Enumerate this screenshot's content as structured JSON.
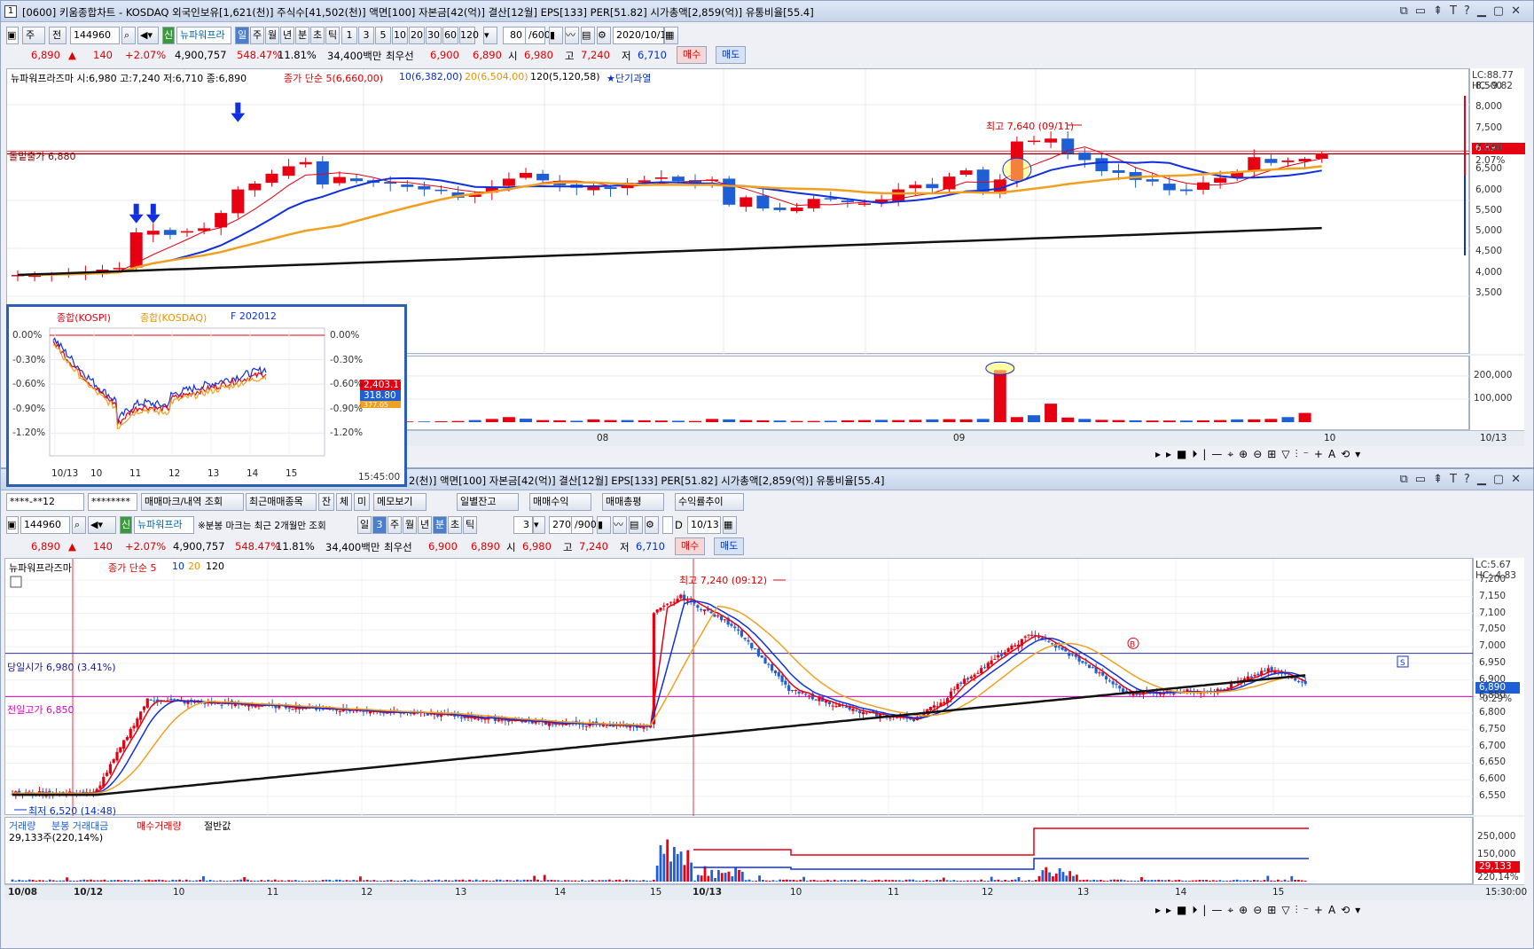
{
  "top": {
    "title": "[0600] 키움종합차트 - KOSDAQ 외국인보유[1,621(천)] 주식수[41,502(천)] 액면[100] 자본금[42(억)] 결산[12월] EPS[133] PER[51.82] 시가총액[2,859(억)] 유통비율[55.4]",
    "window_num": "1",
    "toolbar": {
      "type1": "주",
      "type2": "전",
      "code": "144960",
      "name": "뉴파워프라",
      "periods": [
        "일",
        "주",
        "월",
        "년",
        "분",
        "초",
        "틱"
      ],
      "mins": [
        "1",
        "3",
        "5",
        "10",
        "20",
        "30",
        "60",
        "120"
      ],
      "count": "80",
      "count_total": "/600",
      "date": "2020/10/13"
    },
    "quote": {
      "price": "6,890",
      "change": "140",
      "change_pct": "+2.07%",
      "volume": "4,900,757",
      "vol_ratio": "548.47%",
      "turnover": "11.81%",
      "amount": "34,400백만",
      "best_label": "최우선",
      "ask": "6,900",
      "bid": "6,890",
      "open_label": "시",
      "open": "6,980",
      "high_label": "고",
      "high": "7,240",
      "low_label": "저",
      "low": "6,710",
      "buy": "매수",
      "sell": "매도"
    },
    "legend": {
      "name": "뉴파워프라즈마 시:6,980 고:7,240 저:6,710 종:6,890",
      "ma_title": "종가 단순 5(6,660,00)",
      "ma10": "10(6,382,00)",
      "ma20": "20(6,504,00)",
      "ma120": "120(5,120,58)",
      "star": "★단기과열"
    },
    "y_ticks": [
      "8,500",
      "8,000",
      "7,500",
      "7,000",
      "6,500",
      "6,000",
      "5,500",
      "5,000",
      "4,500",
      "4,000",
      "3,500"
    ],
    "lc": "LC:88.77",
    "hc": "HC:-9.82",
    "last_price": "6,890",
    "last_pct": "2.07%",
    "note_high": "최고 7,640 (09/11)",
    "breakout_label": "돌밑출가 6,880",
    "vol_ticks": [
      "200,000",
      "100,000"
    ],
    "x_labels": [
      "08",
      "09",
      "10"
    ],
    "x_end": "10/13"
  },
  "inset": {
    "legend": [
      "종합(KOSPI)",
      "종합(KOSDAQ)",
      "F 202012"
    ],
    "y_ticks": [
      "0.00%",
      "-0.30%",
      "-0.60%",
      "-0.90%",
      "-1.20%"
    ],
    "vals": [
      "2,403.17",
      "318.80",
      "377.05"
    ],
    "x_labels": [
      "10/13",
      "10",
      "11",
      "12",
      "13",
      "14",
      "15"
    ],
    "time": "15:45:00"
  },
  "bottom": {
    "title": "2(천)] 액면[100] 자본금[42(억)] 결산[12월] EPS[133] PER[51.82] 시가총액[2,859(억)] 유통비율[55.4]",
    "toolbar1": {
      "acct": "****-**12",
      "pw": "********",
      "b1": "매매마크/내역 조회",
      "b2": "최근매매종목",
      "b3": "잔",
      "b4": "체",
      "b5": "미",
      "b6": "메모보기",
      "b7": "일별잔고",
      "b8": "매매수익",
      "b9": "매매총평",
      "b10": "수익률추이"
    },
    "toolbar2": {
      "code": "144960",
      "name": "뉴파워프라",
      "note": "※분봉 마크는 최근 2개월만 조회",
      "periods": [
        "일",
        "3",
        "주",
        "월",
        "년",
        "분",
        "초",
        "틱"
      ],
      "minval": "3",
      "count": "270",
      "count_total": "/900",
      "d_label": "D",
      "date": "10/13"
    },
    "quote": {
      "price": "6,890",
      "change": "140",
      "change_pct": "+2.07%",
      "volume": "4,900,757",
      "vol_ratio": "548.47%",
      "turnover": "11.81%",
      "amount": "34,400백만",
      "best_label": "최우선",
      "ask": "6,900",
      "bid": "6,890",
      "open_label": "시",
      "open": "6,980",
      "high_label": "고",
      "high": "7,240",
      "low_label": "저",
      "low": "6,710",
      "buy": "매수",
      "sell": "매도"
    },
    "legend": {
      "name": "뉴파워프라즈마",
      "ma_title": "종가 단순 5",
      "ma10": "10",
      "ma20": "20",
      "ma120": "120"
    },
    "y_ticks": [
      "7,200",
      "7,150",
      "7,100",
      "7,050",
      "7,000",
      "6,950",
      "6,900",
      "6,850",
      "6,800",
      "6,750",
      "6,700",
      "6,650",
      "6,600",
      "6,550"
    ],
    "lc": "LC:5.67",
    "hc": "HC:-4.83",
    "last_price": "6,890",
    "last_pct": "-0.29%",
    "note_high": "최고 7,240 (09:12)",
    "note_low": "최저 6,520 (14:48)",
    "open_line": "당일시가 6,980 (3.41%)",
    "prev_high": "전일고가 6,850",
    "vol_legend": {
      "v1": "거래량",
      "v2": "분봉 거래대금",
      "v3": "매수거래량",
      "v4": "절반값"
    },
    "vol_value": "29,133주(220,14%)",
    "vol_ticks": [
      "250,000",
      "150,000"
    ],
    "vol_last": "29,133",
    "vol_last_pct": "220,14%",
    "x_labels": [
      "10/08",
      "10/12",
      "10",
      "11",
      "12",
      "13",
      "14",
      "15",
      "10/13",
      "10",
      "11",
      "12",
      "13",
      "14",
      "15"
    ],
    "x_end": "15:30:00"
  },
  "colors": {
    "up": "#e60012",
    "down": "#1f5fd6",
    "ma5": "#e60012",
    "ma10": "#1030e0",
    "ma20": "#f0a020",
    "ma120": "#111111"
  }
}
